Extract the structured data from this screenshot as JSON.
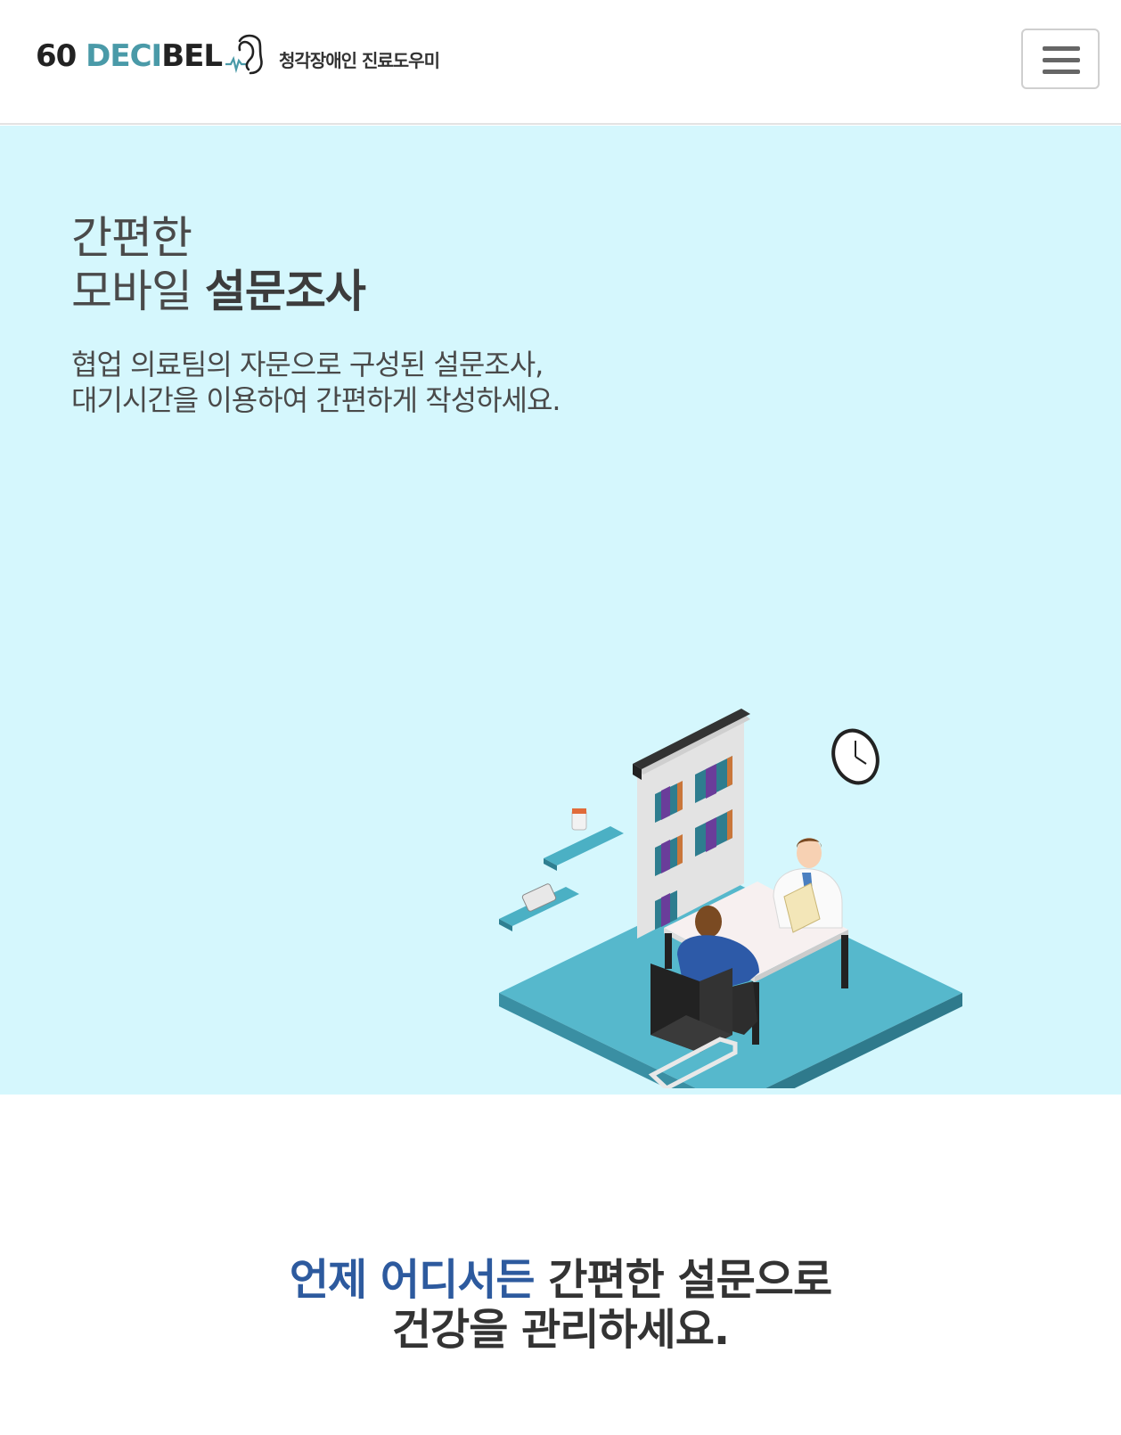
{
  "header": {
    "logo_prefix": "60 ",
    "logo_accent": "DECI",
    "logo_suffix": "BEL",
    "tagline": "청각장애인 진료도우미",
    "menu_icon": "hamburger-menu-icon"
  },
  "hero": {
    "title_line1": "간편한",
    "title_line2_normal": "모바일 ",
    "title_line2_bold": "설문조사",
    "desc_line1": "협업 의료팀의 자문으로 구성된 설문조사,",
    "desc_line2": "대기시간을 이용하여 간편하게 작성하세요.",
    "background_color": "#d5f7fd",
    "illustration": "doctor-consultation-isometric-illustration"
  },
  "section2": {
    "title_accent": "언제 어디서든",
    "title_rest": " 간편한 설문으로",
    "title_line2": "건강을 관리하세요.",
    "accent_color": "#2d5a9e"
  }
}
